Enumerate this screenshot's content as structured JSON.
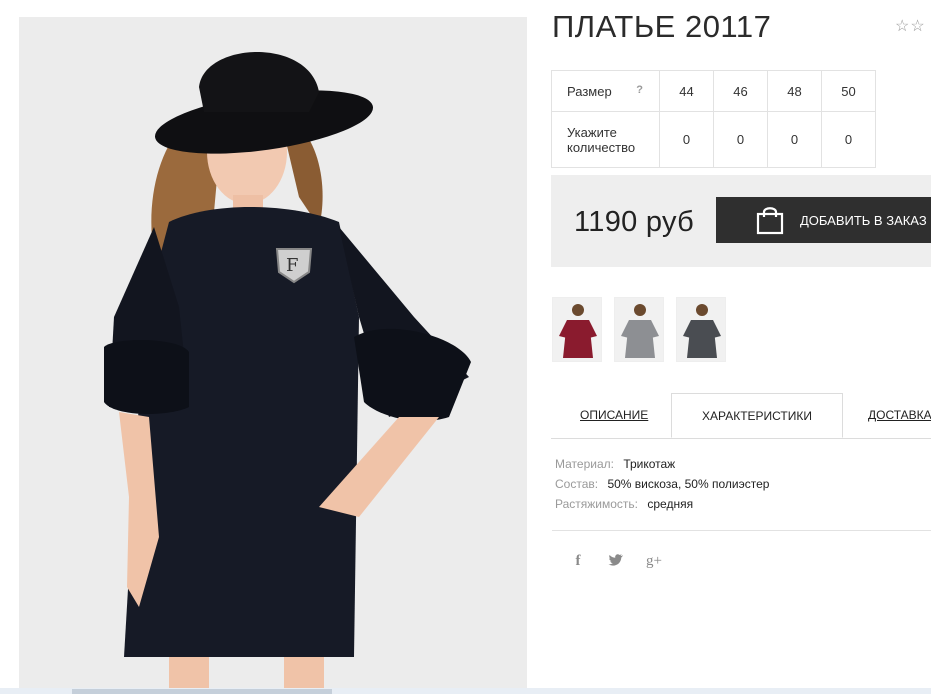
{
  "product": {
    "title": "ПЛАТЬЕ 20117",
    "rating_stars": "☆☆"
  },
  "sizes": {
    "size_label": "Размер",
    "help": "?",
    "qty_label_line1": "Укажите",
    "qty_label_line2": "количество",
    "items": [
      {
        "size": "44",
        "qty": "0"
      },
      {
        "size": "46",
        "qty": "0"
      },
      {
        "size": "48",
        "qty": "0"
      },
      {
        "size": "50",
        "qty": "0"
      }
    ]
  },
  "purchase": {
    "price": "1190 руб",
    "add_button_label": "ДОБАВИТЬ В ЗАКАЗ",
    "icon": "shopping-bag-icon"
  },
  "thumbnails": [
    {
      "color_name": "burgundy",
      "color": "#8a1b2e"
    },
    {
      "color_name": "grey",
      "color": "#8d8f93"
    },
    {
      "color_name": "dark-grey",
      "color": "#4a4d52"
    }
  ],
  "tabs": [
    {
      "label": "ОПИСАНИЕ",
      "active": false
    },
    {
      "label": "ХАРАКТЕРИСТИКИ",
      "active": true
    },
    {
      "label": "ДОСТАВКА",
      "active": false
    }
  ],
  "characteristics": [
    {
      "key": "Материал:",
      "value": "Трикотаж"
    },
    {
      "key": "Состав:",
      "value": "50% вискоза, 50% полиэстер"
    },
    {
      "key": "Растяжимость:",
      "value": "средняя"
    }
  ],
  "social": [
    {
      "icon": "facebook-icon",
      "glyph": "f"
    },
    {
      "icon": "twitter-icon",
      "glyph": "🐦"
    },
    {
      "icon": "google-plus-icon",
      "glyph": "g+"
    }
  ],
  "colors": {
    "button_bg": "#2f2f2f",
    "price_bg": "#eeeeee",
    "dress": "#161a26"
  }
}
